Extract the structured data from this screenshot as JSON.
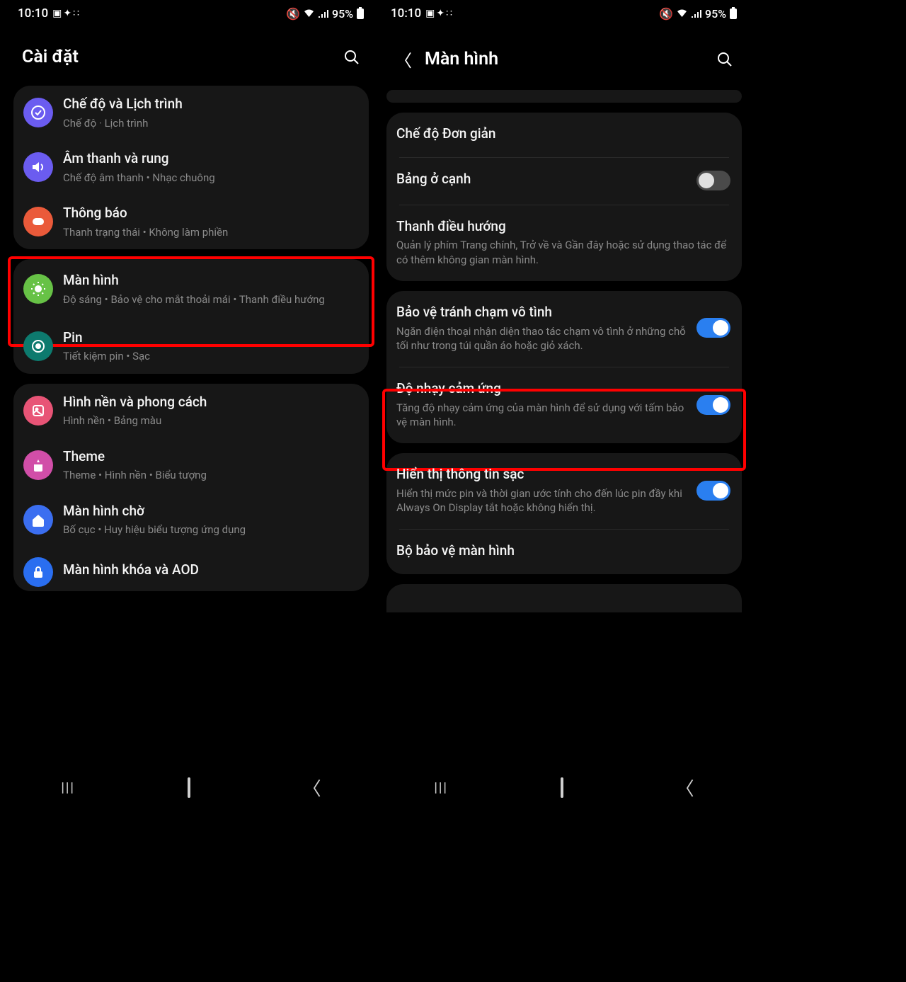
{
  "status": {
    "time": "10:10",
    "battery": "95%"
  },
  "left": {
    "title": "Cài đặt",
    "groups": [
      {
        "rows": [
          {
            "icon": "check",
            "iconCls": "ic-purple-check",
            "title": "Chế độ và Lịch trình",
            "subtitle": "Chế độ  ·  Lịch trình"
          },
          {
            "icon": "sound",
            "iconCls": "ic-purple-sound",
            "title": "Âm thanh và rung",
            "subtitle": "Chế độ âm thanh  •  Nhạc chuông"
          },
          {
            "icon": "notif",
            "iconCls": "ic-orange",
            "title": "Thông báo",
            "subtitle": "Thanh trạng thái  •  Không làm phiền"
          }
        ]
      },
      {
        "rows": [
          {
            "icon": "display",
            "iconCls": "ic-green",
            "title": "Màn hình",
            "subtitle": "Độ sáng  •  Bảo vệ cho mắt thoải mái  •  Thanh điều hướng",
            "highlighted": true
          },
          {
            "icon": "battery",
            "iconCls": "ic-teal",
            "title": "Pin",
            "subtitle": "Tiết kiệm pin  •  Sạc"
          }
        ]
      },
      {
        "rows": [
          {
            "icon": "wallpaper",
            "iconCls": "ic-pink",
            "title": "Hình nền và phong cách",
            "subtitle": "Hình nền  •  Bảng màu"
          },
          {
            "icon": "theme",
            "iconCls": "ic-magenta",
            "title": "Theme",
            "subtitle": "Theme  •  Hình nền  •  Biểu tượng"
          },
          {
            "icon": "home",
            "iconCls": "ic-blue",
            "title": "Màn hình chờ",
            "subtitle": "Bố cục  •  Huy hiệu biểu tượng ứng dụng"
          },
          {
            "icon": "lock",
            "iconCls": "ic-blue2",
            "title": "Màn hình khóa và AOD",
            "subtitle": ""
          }
        ]
      }
    ]
  },
  "right": {
    "title": "Màn hình",
    "scrollHint": true,
    "groups": [
      {
        "rows": [
          {
            "title": "Chế độ Đơn giản",
            "type": "link"
          },
          {
            "title": "Bảng ở cạnh",
            "type": "toggle",
            "on": false
          },
          {
            "title": "Thanh điều hướng",
            "subtitle": "Quản lý phím Trang chính, Trở về và Gần đây hoặc sử dụng thao tác để có thêm không gian màn hình.",
            "type": "link"
          }
        ]
      },
      {
        "rows": [
          {
            "title": "Bảo vệ tránh chạm vô tình",
            "subtitle": "Ngăn điện thoại nhận diện thao tác chạm vô tình ở những chỗ tối như trong túi quần áo hoặc giỏ xách.",
            "type": "toggle",
            "on": true
          },
          {
            "title": "Độ nhạy cảm ứng",
            "subtitle": "Tăng độ nhạy cảm ứng của màn hình để sử dụng với tấm bảo vệ màn hình.",
            "type": "toggle",
            "on": true,
            "highlighted": true
          }
        ]
      },
      {
        "rows": [
          {
            "title": "Hiển thị thông tin sạc",
            "subtitle": "Hiển thị mức pin và thời gian ước tính cho đến lúc pin đầy khi Always On Display tắt hoặc không hiển thị.",
            "type": "toggle",
            "on": true
          },
          {
            "title": "Bộ bảo vệ màn hình",
            "type": "link"
          }
        ]
      }
    ]
  }
}
